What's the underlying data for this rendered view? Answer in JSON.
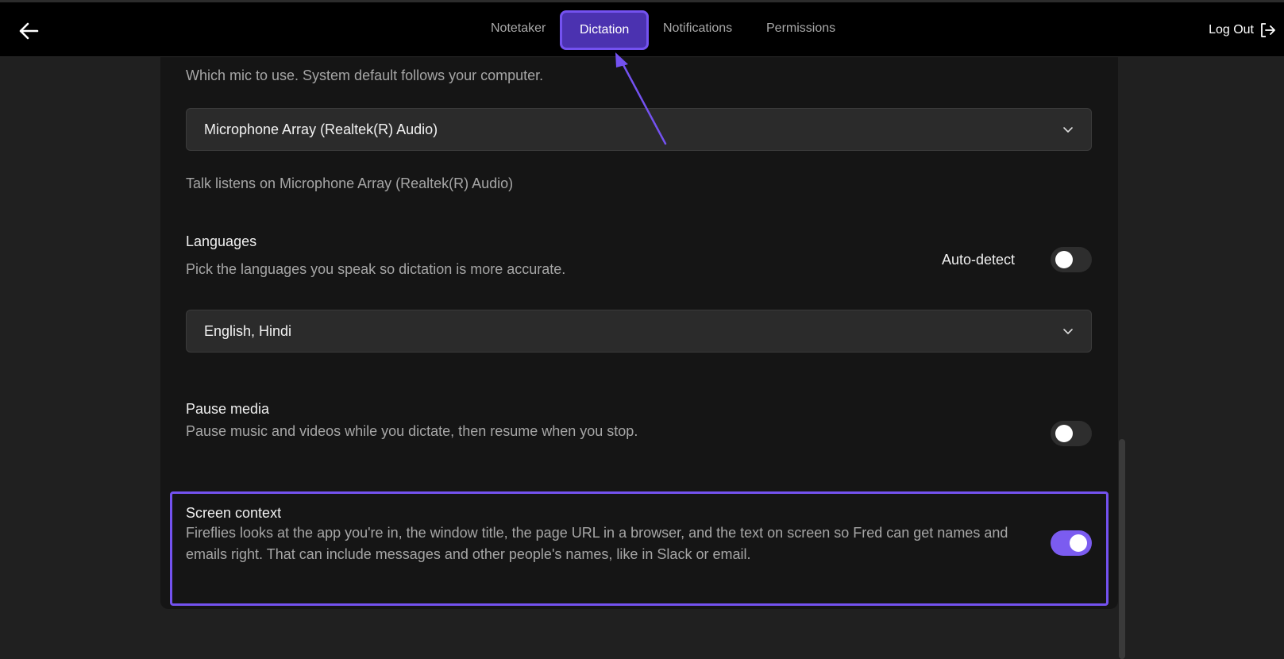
{
  "nav": {
    "tabs": [
      {
        "label": "Notetaker"
      },
      {
        "label": "Dictation",
        "active": true
      },
      {
        "label": "Notifications"
      },
      {
        "label": "Permissions"
      }
    ],
    "logout_label": "Log Out"
  },
  "microphone": {
    "description": "Which mic to use. System default follows your computer.",
    "selected": "Microphone Array (Realtek(R) Audio)",
    "status": "Talk listens on Microphone Array (Realtek(R) Audio)"
  },
  "languages": {
    "title": "Languages",
    "description": "Pick the languages you speak so dictation is more accurate.",
    "auto_detect_label": "Auto-detect",
    "auto_detect_on": false,
    "selected": "English, Hindi"
  },
  "pause_media": {
    "title": "Pause media",
    "description": "Pause music and videos while you dictate, then resume when you stop.",
    "enabled": false
  },
  "screen_context": {
    "title": "Screen context",
    "description": "Fireflies looks at the app you're in, the window title, the page URL in a browser, and the text on screen so Fred can get names and emails right. That can include messages and other people's names, like in Slack or email.",
    "enabled": true
  },
  "colors": {
    "accent": "#7452f0",
    "active_tab_bg": "#4b32b0",
    "toggle_on": "#7b5cf0",
    "background": "#202020",
    "panel": "#151515"
  },
  "icons": {
    "back": "arrow-left-icon",
    "logout": "logout-icon",
    "select_chevron": "chevron-down-icon"
  }
}
